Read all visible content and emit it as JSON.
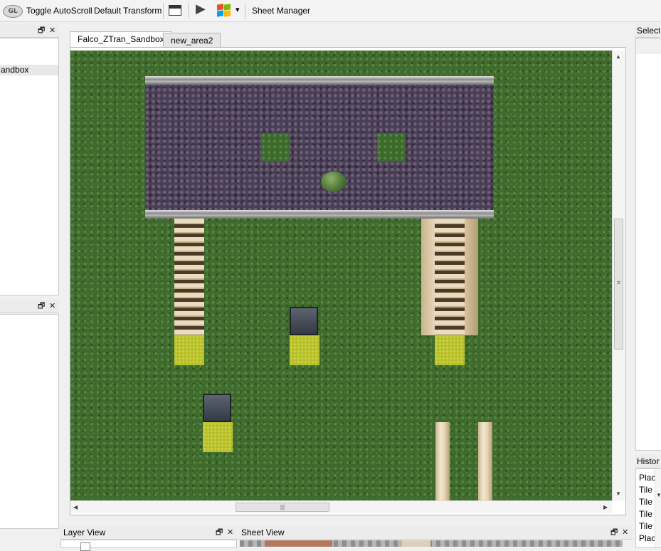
{
  "toolbar": {
    "logo_text": "GL",
    "toggle_autoscroll": "Toggle AutoScroll",
    "default_transform": "Default Transform",
    "play_glyph": "▶",
    "dropdown_glyph": "▾",
    "sheet_manager": "Sheet Manager"
  },
  "left_panel_top": {
    "item_label": "andbox"
  },
  "tabs": [
    {
      "label": "Falco_ZTran_Sandbox",
      "active": true
    },
    {
      "label": "new_area2",
      "active": false
    }
  ],
  "right_panel": {
    "selection_title": "Selectio",
    "history_title": "History",
    "history_items": [
      "Place",
      "Tile C",
      "Tile C",
      "Tile C",
      "Tile C",
      "Place"
    ]
  },
  "bottom_docks": {
    "layer_view_title": "Layer View",
    "sheet_view_title": "Sheet View"
  },
  "dock_controls": {
    "float": "🗗",
    "close": "✕"
  },
  "scroll": {
    "grip": "|||",
    "grip_v": "≡",
    "up": "▲",
    "down": "▼",
    "left": "◀",
    "right": "▶"
  },
  "colors": {
    "grass": "#3f6a2e",
    "stone": "#4a3e55",
    "pad": "#b7c02a"
  }
}
